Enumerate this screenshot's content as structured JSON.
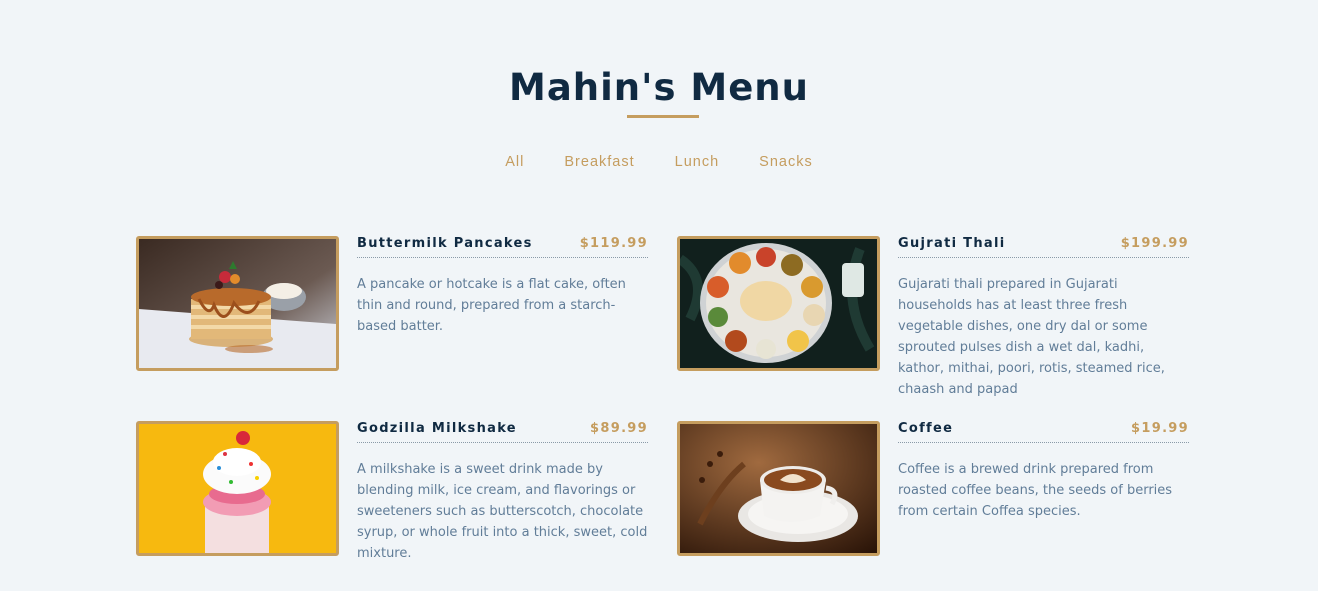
{
  "title": "Mahin's Menu",
  "filters": [
    "All",
    "Breakfast",
    "Lunch",
    "Snacks"
  ],
  "colors": {
    "accent": "#c59d5f",
    "heading": "#102a42",
    "text": "#617d98",
    "background": "#f1f5f8"
  },
  "items": [
    {
      "name": "Buttermilk Pancakes",
      "price": "$119.99",
      "description": "A pancake or hotcake is a flat cake, often thin and round, prepared from a starch-based batter.",
      "image": "pancakes-photo"
    },
    {
      "name": "Gujrati Thali",
      "price": "$199.99",
      "description": "Gujarati thali prepared in Gujarati households has at least three fresh vegetable dishes, one dry dal or some sprouted pulses dish a wet dal, kadhi, kathor, mithai, poori, rotis, steamed rice, chaash and papad",
      "image": "thali-photo"
    },
    {
      "name": "Godzilla Milkshake",
      "price": "$89.99",
      "description": "A milkshake is a sweet drink made by blending milk, ice cream, and flavorings or sweeteners such as butterscotch, chocolate syrup, or whole fruit into a thick, sweet, cold mixture.",
      "image": "milkshake-photo"
    },
    {
      "name": "Coffee",
      "price": "$19.99",
      "description": "Coffee is a brewed drink prepared from roasted coffee beans, the seeds of berries from certain Coffea species.",
      "image": "coffee-photo"
    }
  ]
}
